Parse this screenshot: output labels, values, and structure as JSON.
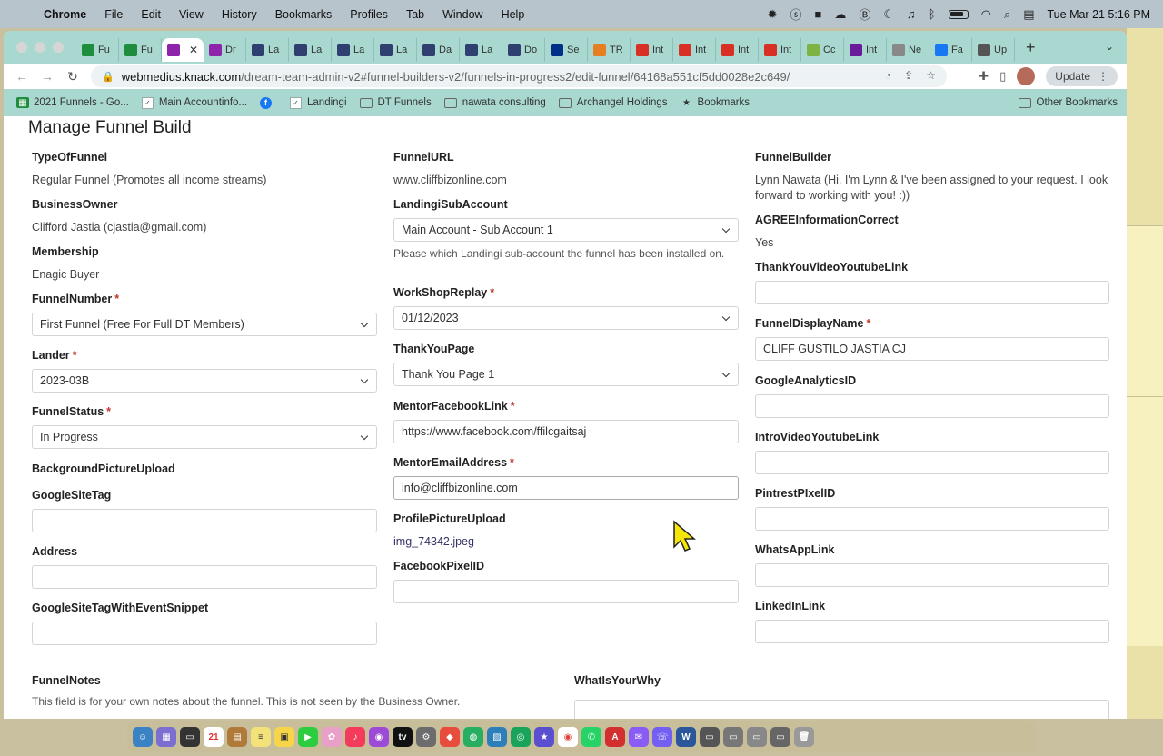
{
  "menubar": {
    "app_name": "Chrome",
    "items": [
      "File",
      "Edit",
      "View",
      "History",
      "Bookmarks",
      "Profiles",
      "Tab",
      "Window",
      "Help"
    ],
    "datetime": "Tue Mar 21  5:16 PM"
  },
  "tabs": [
    {
      "label": "Fu",
      "icon": "sheets-icon",
      "color": "#1e8e3e"
    },
    {
      "label": "Fu",
      "icon": "sheets-icon",
      "color": "#1e8e3e"
    },
    {
      "label": "",
      "icon": "knack-icon",
      "color": "#8e24aa",
      "active": true
    },
    {
      "label": "Dr",
      "icon": "knack-icon",
      "color": "#8e24aa"
    },
    {
      "label": "La",
      "icon": "landingi-icon",
      "color": "#2f3f6f"
    },
    {
      "label": "La",
      "icon": "landingi-icon",
      "color": "#2f3f6f"
    },
    {
      "label": "La",
      "icon": "landingi-icon",
      "color": "#2f3f6f"
    },
    {
      "label": "La",
      "icon": "landingi-icon",
      "color": "#2f3f6f"
    },
    {
      "label": "Da",
      "icon": "landingi-icon",
      "color": "#2f3f6f"
    },
    {
      "label": "La",
      "icon": "landingi-icon",
      "color": "#2f3f6f"
    },
    {
      "label": "Do",
      "icon": "landingi-icon",
      "color": "#2f3f6f"
    },
    {
      "label": "Se",
      "icon": "paypal-icon",
      "color": "#003087"
    },
    {
      "label": "TR",
      "icon": "tr-icon",
      "color": "#e67e22"
    },
    {
      "label": "Int",
      "icon": "gmail-icon",
      "color": "#d93025"
    },
    {
      "label": "Int",
      "icon": "gmail-icon",
      "color": "#d93025"
    },
    {
      "label": "Int",
      "icon": "gmail-icon",
      "color": "#d93025"
    },
    {
      "label": "Int",
      "icon": "gmail-icon",
      "color": "#d93025"
    },
    {
      "label": "Cc",
      "icon": "cc-icon",
      "color": "#7cb342"
    },
    {
      "label": "Int",
      "icon": "app-icon",
      "color": "#6a1b9a"
    },
    {
      "label": "Ne",
      "icon": "chatgpt-icon",
      "color": "#888888"
    },
    {
      "label": "Fa",
      "icon": "facebook-icon",
      "color": "#1877f2"
    },
    {
      "label": "Up",
      "icon": "up-icon",
      "color": "#555555"
    }
  ],
  "omnibox": {
    "host": "webmedius.knack.com",
    "path": "/dream-team-admin-v2#funnel-builders-v2/funnels-in-progress2/edit-funnel/64168a551cf5dd0028e2c649/"
  },
  "toolbar": {
    "update_label": "Update"
  },
  "bookmarks": [
    {
      "label": "2021 Funnels - Go...",
      "icon": "sheets-icon"
    },
    {
      "label": "Main Accountinfo...",
      "icon": "landingi-icon"
    },
    {
      "label": "",
      "icon": "facebook-icon"
    },
    {
      "label": "Landingi",
      "icon": "landingi-icon"
    },
    {
      "label": "DT Funnels",
      "icon": "folder-icon"
    },
    {
      "label": "nawata consulting",
      "icon": "folder-icon"
    },
    {
      "label": "Archangel Holdings",
      "icon": "folder-icon"
    },
    {
      "label": "Bookmarks",
      "icon": "star-icon"
    }
  ],
  "bookmarks_other": "Other Bookmarks",
  "page": {
    "title": "Manage Funnel Build",
    "col1": {
      "type_of_funnel": {
        "label": "TypeOfFunnel",
        "value": "Regular Funnel (Promotes all income streams)"
      },
      "business_owner": {
        "label": "BusinessOwner",
        "value": "Clifford Jastia (cjastia@gmail.com)"
      },
      "membership": {
        "label": "Membership",
        "value": "Enagic Buyer"
      },
      "funnel_number": {
        "label": "FunnelNumber",
        "value": "First Funnel (Free For Full DT Members)"
      },
      "lander": {
        "label": "Lander",
        "value": "2023-03B"
      },
      "funnel_status": {
        "label": "FunnelStatus",
        "value": "In Progress"
      },
      "background_upload": {
        "label": "BackgroundPictureUpload"
      },
      "google_site_tag": {
        "label": "GoogleSiteTag",
        "value": ""
      },
      "address": {
        "label": "Address",
        "value": ""
      },
      "google_site_tag_event": {
        "label": "GoogleSiteTagWithEventSnippet",
        "value": ""
      }
    },
    "col2": {
      "funnel_url": {
        "label": "FunnelURL",
        "value": "www.cliffbizonline.com"
      },
      "landingi_sub": {
        "label": "LandingiSubAccount",
        "value": "Main Account - Sub Account 1",
        "help": "Please which Landingi sub-account the funnel has been installed on."
      },
      "workshop_replay": {
        "label": "WorkShopReplay",
        "value": "01/12/2023"
      },
      "thank_you_page": {
        "label": "ThankYouPage",
        "value": "Thank You Page 1"
      },
      "mentor_facebook": {
        "label": "MentorFacebookLink",
        "value": "https://www.facebook.com/ffilcgaitsaj"
      },
      "mentor_email": {
        "label": "MentorEmailAddress",
        "value": "info@cliffbizonline.com"
      },
      "profile_upload": {
        "label": "ProfilePictureUpload",
        "value": "img_74342.jpeg"
      },
      "facebook_pixel": {
        "label": "FacebookPixelID",
        "value": ""
      }
    },
    "col3": {
      "funnel_builder": {
        "label": "FunnelBuilder",
        "value": "Lynn Nawata (Hi, I'm Lynn & I've been assigned to your request. I look forward to working with you! :))"
      },
      "agree_info": {
        "label": "AGREEInformationCorrect",
        "value": "Yes"
      },
      "thank_you_video": {
        "label": "ThankYouVideoYoutubeLink",
        "value": ""
      },
      "funnel_display_name": {
        "label": "FunnelDisplayName",
        "value": "CLIFF GUSTILO JASTIA CJ"
      },
      "google_analytics": {
        "label": "GoogleAnalyticsID",
        "value": ""
      },
      "intro_video": {
        "label": "IntroVideoYoutubeLink",
        "value": ""
      },
      "pinterest_pixel": {
        "label": "PintrestPIxelID",
        "value": ""
      },
      "whatsapp": {
        "label": "WhatsAppLink",
        "value": ""
      },
      "linkedin": {
        "label": "LinkedInLink",
        "value": ""
      }
    },
    "funnel_notes": {
      "label": "FunnelNotes",
      "help": "This field is for your own notes about the funnel. This is not seen by the Business Owner."
    },
    "what_is_your_why": {
      "label": "WhatIsYourWhy"
    }
  }
}
